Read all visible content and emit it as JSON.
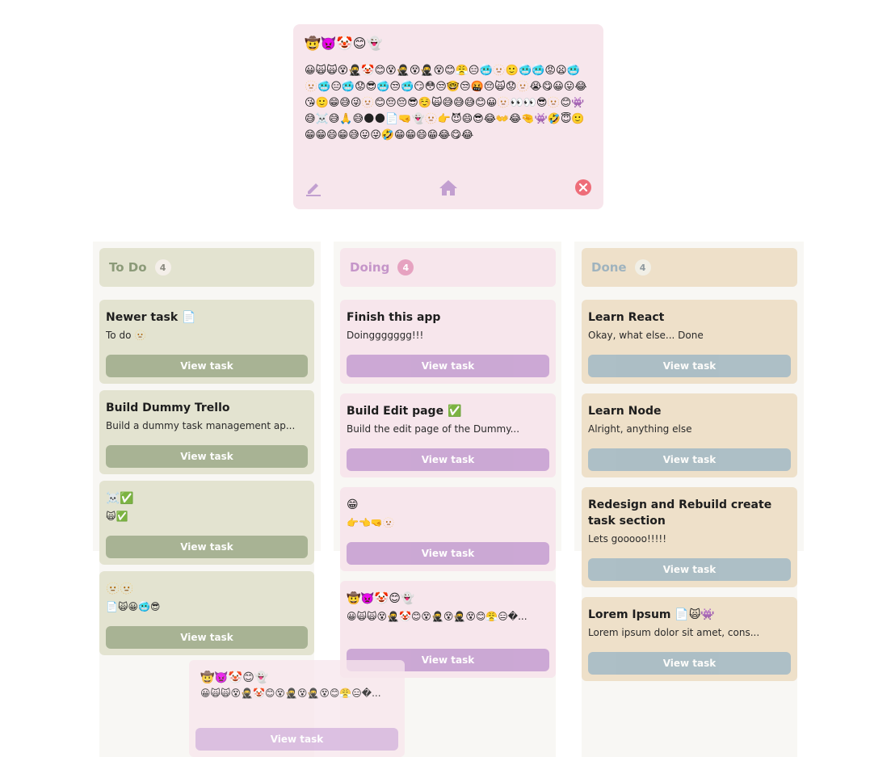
{
  "modal": {
    "title": "🤠👿🤡😊👻",
    "description": "😀🙀🙀😵🥷🤡😊😵🥷😵🥷😵😊😤😑🥶🫥🙂🥶🥶😡😦🥶🫥🥶😑🥶😟😎🥶😒🥶😏😳😒🤓😒🤬😔🙀😟🫥😭😋😀😛😂😘🙂😁😅😜🫥😊😔😔😎☺️🙀😅😅😅😊😀🫥👀👀😎🫥😊👾😅☠️😅🙏😅🌑🌑📄🤜👻🫥👉😈😄😎😂👐😂🤏👾🤣😇🙂😁😁😄😁😅😛😜🤣😁😁😄😁😂😋😂",
    "icons": {
      "edit": "pencil-icon",
      "home": "home-icon",
      "close": "close-circle-icon"
    }
  },
  "columns": {
    "todo": {
      "title": "To Do",
      "count": "4"
    },
    "doing": {
      "title": "Doing",
      "count": "4"
    },
    "done": {
      "title": "Done",
      "count": "4"
    }
  },
  "view_label": "View task",
  "todo_cards": [
    {
      "title": "Newer task 📄",
      "desc": "To do 🫥"
    },
    {
      "title": "Build Dummy Trello",
      "desc": "Build a dummy task management ap..."
    },
    {
      "title": "☠️✅",
      "desc": "🙀✅"
    },
    {
      "title": "🫥🫥",
      "desc": "📄🙀😀🥶😎"
    }
  ],
  "doing_cards": [
    {
      "title": "Finish this app",
      "desc": "Doinggggggg!!!"
    },
    {
      "title": "Build Edit page ✅",
      "desc": "Build the edit page of the Dummy..."
    },
    {
      "title": "😁",
      "desc": "👉👈🤜🫥"
    },
    {
      "title": "🤠👿🤡😊👻",
      "desc": "😀🙀🙀😵🥷🤡😊😵🥷😵🥷😵😊😤😑�..."
    }
  ],
  "done_cards": [
    {
      "title": "Learn React",
      "desc": "Okay, what else... Done"
    },
    {
      "title": "Learn Node",
      "desc": "Alright, anything else"
    },
    {
      "title": "Redesign and Rebuild create task section",
      "desc": "Lets gooooo!!!!!"
    },
    {
      "title": "Lorem Ipsum 📄🙀👾",
      "desc": "Lorem ipsum dolor sit amet, cons..."
    }
  ],
  "drag_ghost": {
    "title": "🤠👿🤡😊👻",
    "desc": "😀🙀🙀😵🥷🤡😊😵🥷😵🥷😵😊😤😑�..."
  }
}
